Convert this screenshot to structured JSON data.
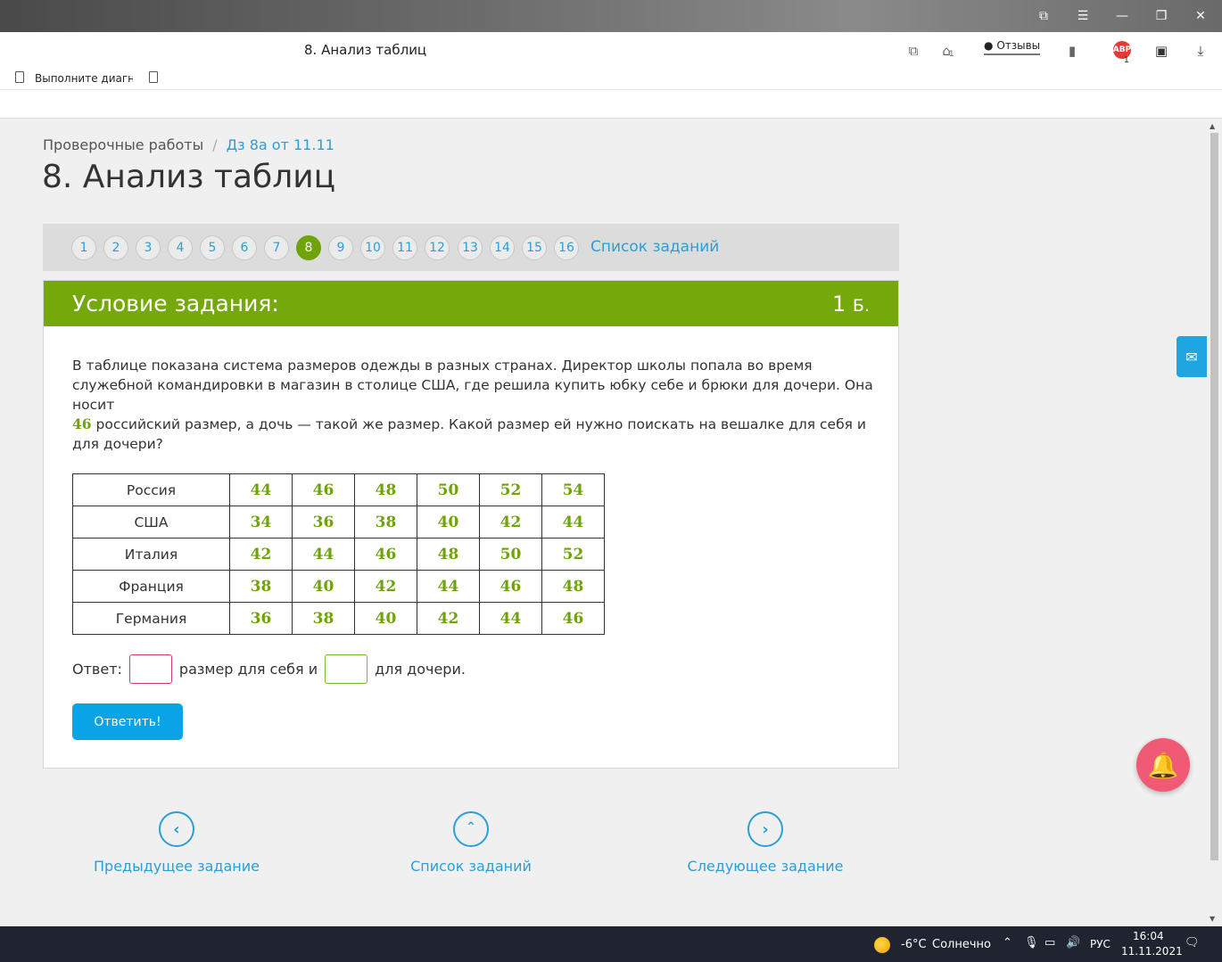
{
  "browser": {
    "tab_title": "8. Анализ таблиц",
    "reviews_label": "Отзывы",
    "badge_count": "1",
    "abp_label": "ABP",
    "abp_count": "1",
    "bookmark_label": "Выполните диагно"
  },
  "page": {
    "breadcrumb": {
      "root": "Проверочные работы",
      "separator": "/",
      "current": "Дз 8а от 11.11"
    },
    "title": "8. Анализ таблиц",
    "task_numbers": [
      "1",
      "2",
      "3",
      "4",
      "5",
      "6",
      "7",
      "8",
      "9",
      "10",
      "11",
      "12",
      "13",
      "14",
      "15",
      "16"
    ],
    "active_task": "8",
    "task_list_link": "Список заданий"
  },
  "task": {
    "header_title": "Условие задания:",
    "points": "1",
    "points_unit": "Б.",
    "text_part1": "В таблице показана система размеров одежды в разных странах. Директор школы попала во время служебной командировки в магазин в столице США, где решила купить юбку себе и брюки для дочери. Она носит",
    "highlight_number": "46",
    "text_part2": "российский размер, а дочь — такой же размер. Какой размер ей нужно поискать на вешалке для себя и для дочери?",
    "table": [
      {
        "country": "Россия",
        "values": [
          "44",
          "46",
          "48",
          "50",
          "52",
          "54"
        ]
      },
      {
        "country": "США",
        "values": [
          "34",
          "36",
          "38",
          "40",
          "42",
          "44"
        ]
      },
      {
        "country": "Италия",
        "values": [
          "42",
          "44",
          "46",
          "48",
          "50",
          "52"
        ]
      },
      {
        "country": "Франция",
        "values": [
          "38",
          "40",
          "42",
          "44",
          "46",
          "48"
        ]
      },
      {
        "country": "Германия",
        "values": [
          "36",
          "38",
          "40",
          "42",
          "44",
          "46"
        ]
      }
    ],
    "answer_label": "Ответ:",
    "answer_mid": "размер для себя и",
    "answer_end": "для дочери.",
    "answer_self_value": "",
    "answer_daughter_value": "",
    "submit_label": "Ответить!"
  },
  "bottom_nav": {
    "prev_label": "Предыдущее задание",
    "list_label": "Список заданий",
    "next_label": "Следующее задание"
  },
  "taskbar": {
    "temperature": "-6°C",
    "weather": "Солнечно",
    "language": "РУС",
    "time": "16:04",
    "date": "11.11.2021"
  },
  "colors": {
    "accent_green": "#74a80b",
    "link_blue": "#2a9fd6",
    "button_blue": "#0aa3e6",
    "bell_pink": "#f05a74"
  }
}
